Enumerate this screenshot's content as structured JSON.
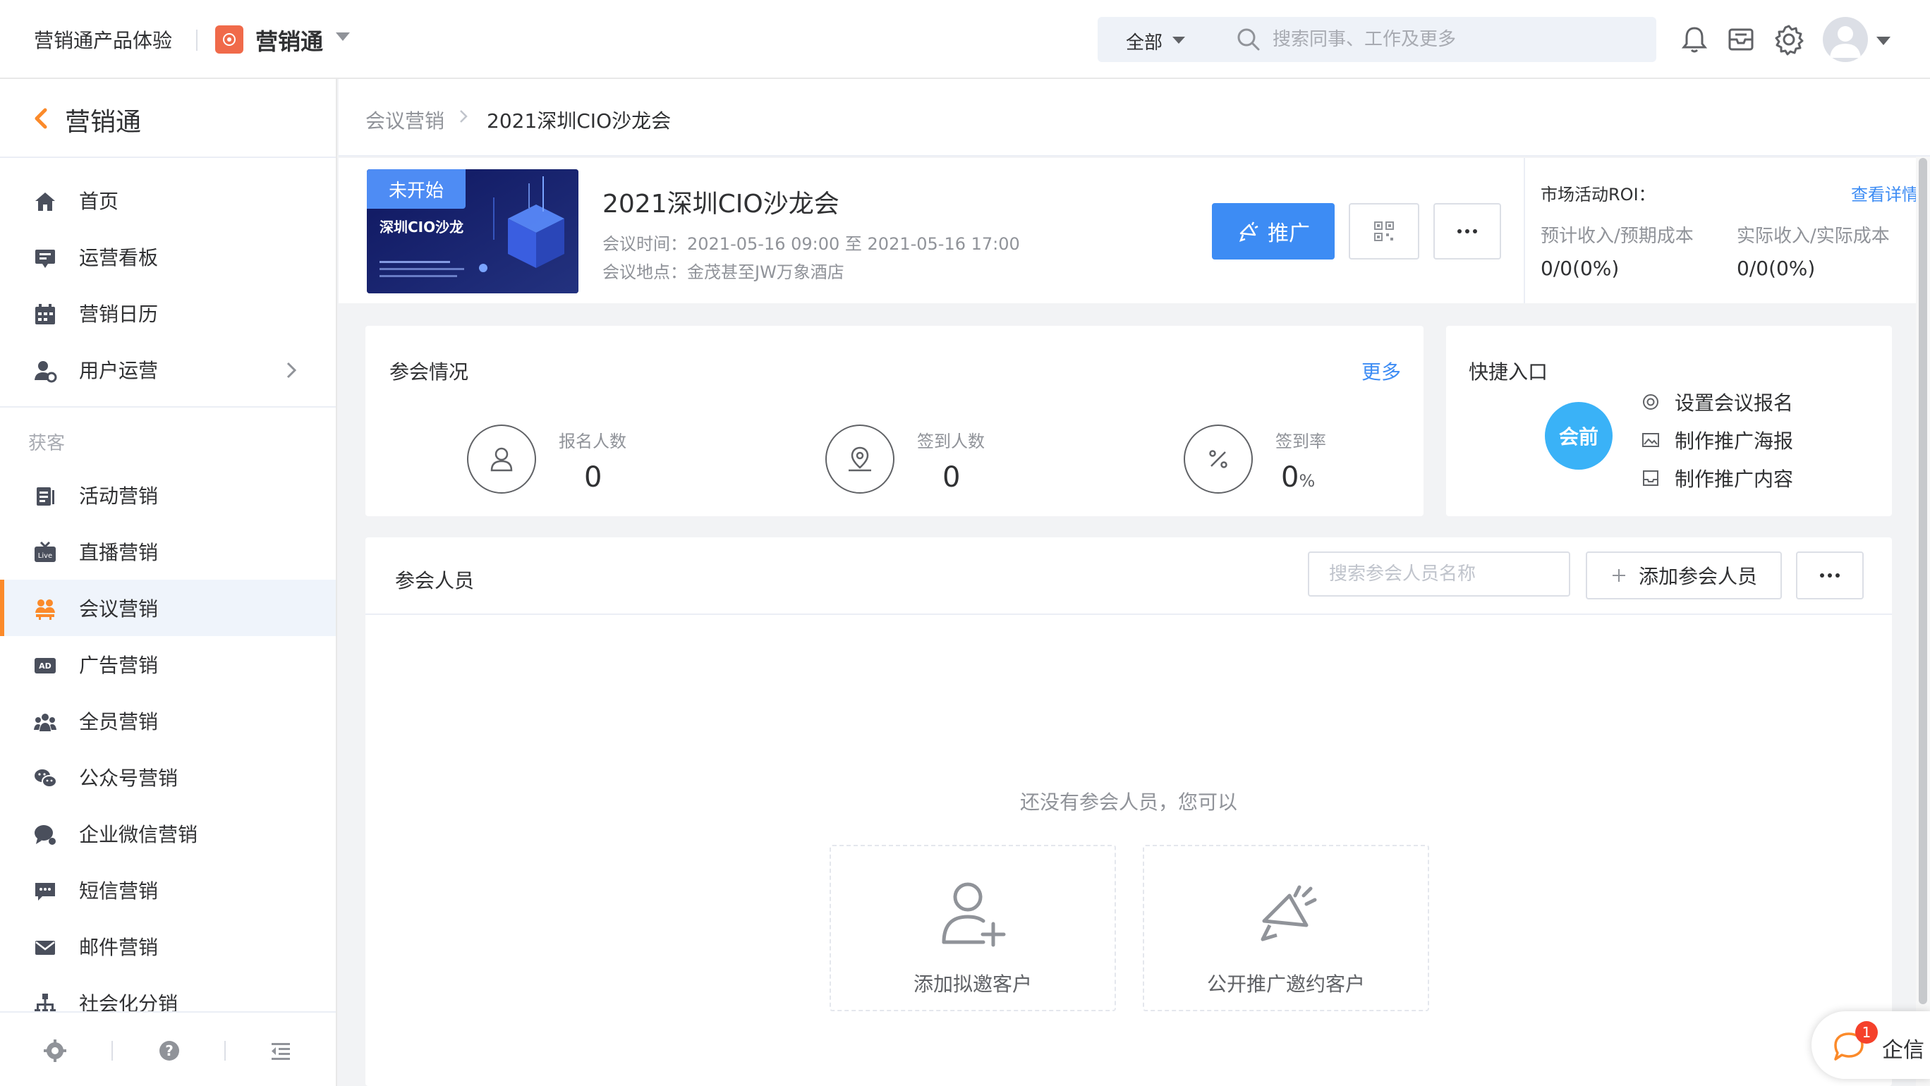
{
  "topbar": {
    "app_name": "营销通产品体验",
    "product_name": "营销通",
    "search_scope": "全部",
    "search_placeholder": "搜索同事、工作及更多"
  },
  "sidebar": {
    "title": "营销通",
    "items_top": [
      {
        "label": "首页",
        "icon": "home-icon"
      },
      {
        "label": "运营看板",
        "icon": "dashboard-icon"
      },
      {
        "label": "营销日历",
        "icon": "calendar-icon"
      },
      {
        "label": "用户运营",
        "icon": "user-ops-icon"
      }
    ],
    "group_label": "获客",
    "items_acquire": [
      {
        "label": "活动营销",
        "icon": "activity-icon"
      },
      {
        "label": "直播营销",
        "icon": "live-icon"
      },
      {
        "label": "会议营销",
        "icon": "meeting-icon"
      },
      {
        "label": "广告营销",
        "icon": "ad-icon"
      },
      {
        "label": "全员营销",
        "icon": "team-icon"
      },
      {
        "label": "公众号营销",
        "icon": "wechat-icon"
      },
      {
        "label": "企业微信营销",
        "icon": "wecom-icon"
      },
      {
        "label": "短信营销",
        "icon": "sms-icon"
      },
      {
        "label": "邮件营销",
        "icon": "mail-icon"
      },
      {
        "label": "社会化分销",
        "icon": "distribution-icon"
      }
    ],
    "active_item": "会议营销"
  },
  "breadcrumb": {
    "parent": "会议营销",
    "current": "2021深圳CIO沙龙会"
  },
  "event": {
    "status": "未开始",
    "poster_title": "深圳CIO沙龙",
    "title": "2021深圳CIO沙龙会",
    "time_label": "会议时间：",
    "time_value": "2021-05-16 09:00 至 2021-05-16 17:00",
    "location_label": "会议地点：",
    "location_value": "金茂甚至JW万象酒店",
    "promote_label": "推广"
  },
  "roi": {
    "title": "市场活动ROI：",
    "link": "查看详情",
    "expected_label": "预计收入/预期成本",
    "expected_value": "0/0(0%)",
    "actual_label": "实际收入/实际成本",
    "actual_value": "0/0(0%)"
  },
  "participation": {
    "title": "参会情况",
    "more": "更多",
    "stats": [
      {
        "label": "报名人数",
        "value": "0",
        "unit": ""
      },
      {
        "label": "签到人数",
        "value": "0",
        "unit": ""
      },
      {
        "label": "签到率",
        "value": "0",
        "unit": "%"
      }
    ]
  },
  "quick_entry": {
    "title": "快捷入口",
    "stage": "会前",
    "items": [
      "设置会议报名",
      "制作推广海报",
      "制作推广内容"
    ]
  },
  "attendees": {
    "title": "参会人员",
    "search_placeholder": "搜索参会人员名称",
    "add_label": "添加参会人员",
    "empty_text": "还没有参会人员，您可以",
    "actions": [
      "添加拟邀客户",
      "公开推广邀约客户"
    ]
  },
  "qixin": {
    "label": "企信",
    "badge": "1"
  },
  "colors": {
    "primary": "#3d8cf4",
    "accent": "#fb8a2a",
    "stage": "#3ab2f7",
    "badge": "#f5412b"
  }
}
